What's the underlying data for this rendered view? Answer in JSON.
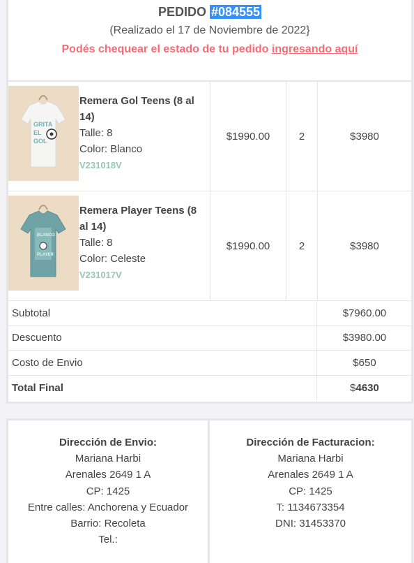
{
  "header": {
    "title_prefix": "PEDIDO",
    "order_number": "#084555",
    "date_text": "(Realizado el 17 de Noviembre de 2022}",
    "check_text": "Podés chequear el estado de tu pedido",
    "check_link": "ingresando aquí"
  },
  "items": [
    {
      "name": "Remera Gol Teens (8 al 14)",
      "size": "Talle: 8",
      "color": "Color: Blanco",
      "sku": "V231018V",
      "unit_price": "$1990.00",
      "quantity": "2",
      "total": "$3980",
      "shirt_color": "#f5f5f3",
      "print_text": "GRITA EL GOL"
    },
    {
      "name": "Remera Player Teens (8 al 14)",
      "size": "Talle: 8",
      "color": "Color: Celeste",
      "sku": "V231017V",
      "unit_price": "$1990.00",
      "quantity": "2",
      "total": "$3980",
      "shirt_color": "#6fa3a6",
      "print_text": "BLANCO PLAYER"
    }
  ],
  "totals": [
    {
      "label": "Subtotal",
      "value": "$7960.00"
    },
    {
      "label": "Descuento",
      "value": "$3980.00"
    },
    {
      "label": "Costo de Envio",
      "value": "$650"
    }
  ],
  "total_final": {
    "label": "Total Final",
    "currency": "$",
    "amount": "4630"
  },
  "shipping": {
    "heading": "Dirección de Envio:",
    "lines": [
      "Mariana Harbi",
      "Arenales 2649 1 A",
      "CP: 1425",
      "Entre calles: Anchorena y Ecuador",
      "Barrio: Recoleta",
      "Tel.:"
    ]
  },
  "billing": {
    "heading": "Dirección de Facturacion:",
    "lines": [
      "Mariana Harbi",
      "Arenales 2649 1 A",
      "CP: 1425",
      "T: 1134673354",
      "DNI: 31453370"
    ]
  }
}
